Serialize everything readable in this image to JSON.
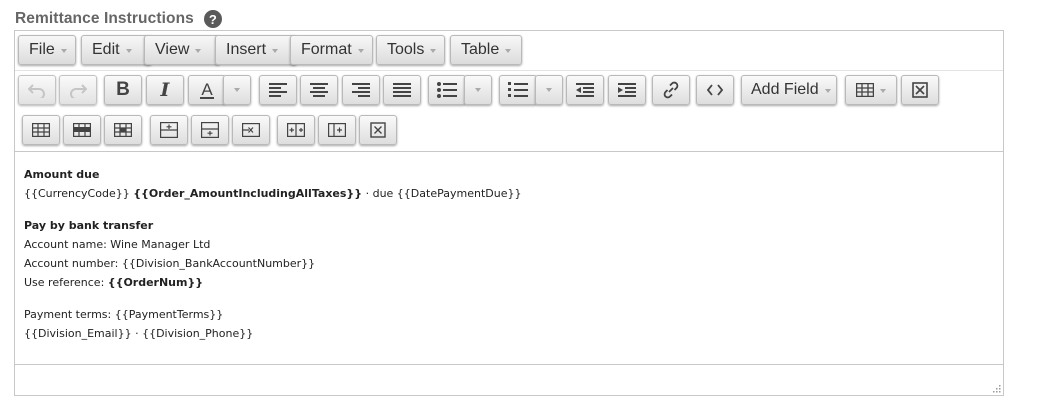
{
  "header": {
    "title": "Remittance Instructions",
    "help_glyph": "?"
  },
  "menubar": {
    "items": [
      {
        "label": "File"
      },
      {
        "label": "Edit"
      },
      {
        "label": "View"
      },
      {
        "label": "Insert"
      },
      {
        "label": "Format"
      },
      {
        "label": "Tools"
      },
      {
        "label": "Table"
      }
    ]
  },
  "toolbar": {
    "add_field_label": "Add Field",
    "icons": [
      "undo-icon",
      "redo-icon",
      "bold-icon",
      "italic-icon",
      "text-color-icon",
      "align-left-icon",
      "align-center-icon",
      "align-right-icon",
      "justify-icon",
      "bullet-list-icon",
      "numbered-list-icon",
      "outdent-icon",
      "indent-icon",
      "link-icon",
      "source-code-icon",
      "table-icon",
      "clear-formatting-icon",
      "table-row-props-icon",
      "table-cell-props-icon",
      "table-merge-icon",
      "insert-row-before-icon",
      "insert-row-after-icon",
      "delete-row-icon",
      "insert-column-before-icon",
      "insert-column-after-icon",
      "delete-column-icon"
    ],
    "bold_glyph": "B",
    "italic_glyph": "I",
    "text_color_glyph": "A"
  },
  "content": {
    "amount_heading": "Amount due",
    "currency_code": "{{CurrencyCode}}",
    "order_amount": "{{Order_AmountIncludingAllTaxes}}",
    "due_text": "· due {{DatePaymentDue}}",
    "bank_heading": "Pay by bank transfer",
    "account_name": "Account name: Wine Manager Ltd",
    "account_number": "Account number: {{Division_BankAccountNumber}}",
    "use_reference_label": "Use reference:",
    "order_num": "{{OrderNum}}",
    "payment_terms": "Payment terms: {{PaymentTerms}}",
    "division_contact": "{{Division_Email}} · {{Division_Phone}}"
  },
  "colors": {
    "title": "#666666",
    "button_top": "#f7f7f7",
    "button_bottom": "#dcdcdc",
    "border": "#c8c8c8"
  }
}
